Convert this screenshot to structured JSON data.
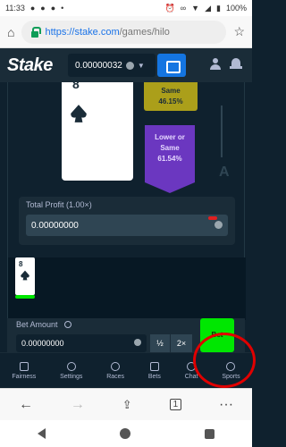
{
  "status": {
    "time": "11:33",
    "battery": "100%"
  },
  "browser": {
    "url_host": "https://stake.com",
    "url_path": "/games/hilo"
  },
  "header": {
    "logo": "Stake",
    "balance": "0.00000032"
  },
  "game": {
    "card_rank": "8",
    "same_title": "Same",
    "same_pct": "46.15%",
    "lower_line1": "Lower or",
    "lower_line2": "Same",
    "lower_pct": "61.54%",
    "ace_label": "A",
    "profit_label": "Total Profit (1.00×)",
    "profit_value": "0.00000000",
    "history_rank": "8"
  },
  "bet": {
    "label": "Bet Amount",
    "value": "0.00000000",
    "half": "½",
    "double": "2×",
    "action": "Bet"
  },
  "nav": [
    "Fairness",
    "Settings",
    "Races",
    "Bets",
    "Chat",
    "Sports"
  ],
  "browser_bottom": {
    "back": "←",
    "forward": "→",
    "tabs": "1",
    "menu": "···"
  }
}
